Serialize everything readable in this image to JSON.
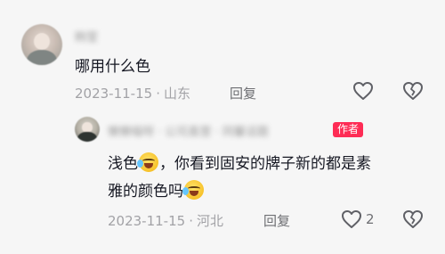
{
  "comments": [
    {
      "username": "韩莹",
      "text": "哪用什么色",
      "date": "2023-11-15",
      "location": "山东",
      "reply_label": "回复",
      "like_count": ""
    },
    {
      "username": "懒懒喵呀 · 公司直营 · 同馨话题",
      "badge": "作者",
      "text_line1": "浅色",
      "text_line1_rest": "，你看到固安的牌子新的都是素",
      "text_line2": "雅的颜色吗",
      "date": "2023-11-15",
      "location": "河北",
      "reply_label": "回复",
      "like_count": "2"
    }
  ],
  "meta_separator": "·",
  "icons": [
    "heart-icon",
    "dislike-icon",
    "laughing-crying-emoji-icon"
  ],
  "colors": {
    "badge": "#fe2c55",
    "meta": "#a2a2a6",
    "background": "#f6f6f6"
  }
}
